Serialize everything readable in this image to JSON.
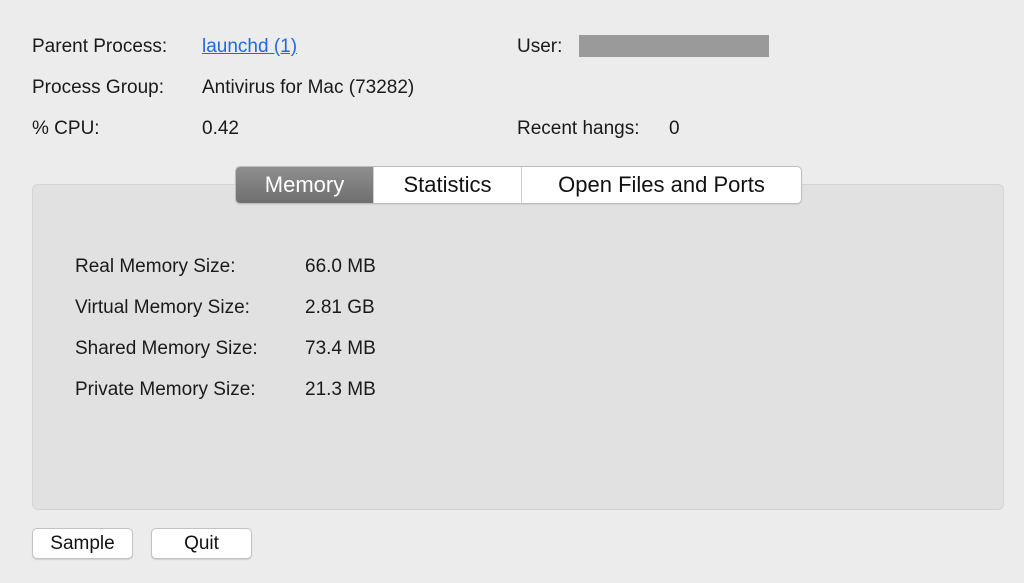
{
  "process_info": {
    "parent_process_label": "Parent Process:",
    "parent_process_value": "launchd (1)",
    "process_group_label": "Process Group:",
    "process_group_value": "Antivirus for Mac (73282)",
    "cpu_label": "% CPU:",
    "cpu_value": "0.42",
    "user_label": "User:",
    "recent_hangs_label": "Recent hangs:",
    "recent_hangs_value": "0"
  },
  "tabs": [
    {
      "label": "Memory",
      "active": true
    },
    {
      "label": "Statistics",
      "active": false
    },
    {
      "label": "Open Files and Ports",
      "active": false
    }
  ],
  "memory": {
    "real_label": "Real Memory Size:",
    "real_value": "66.0 MB",
    "virtual_label": "Virtual Memory Size:",
    "virtual_value": "2.81 GB",
    "shared_label": "Shared Memory Size:",
    "shared_value": "73.4 MB",
    "private_label": "Private Memory Size:",
    "private_value": "21.3 MB"
  },
  "buttons": {
    "sample_label": "Sample",
    "quit_label": "Quit"
  },
  "colors": {
    "link": "#1d6ae5",
    "redaction": "#9a9a9a",
    "active_tab": "#7c7c7c"
  }
}
